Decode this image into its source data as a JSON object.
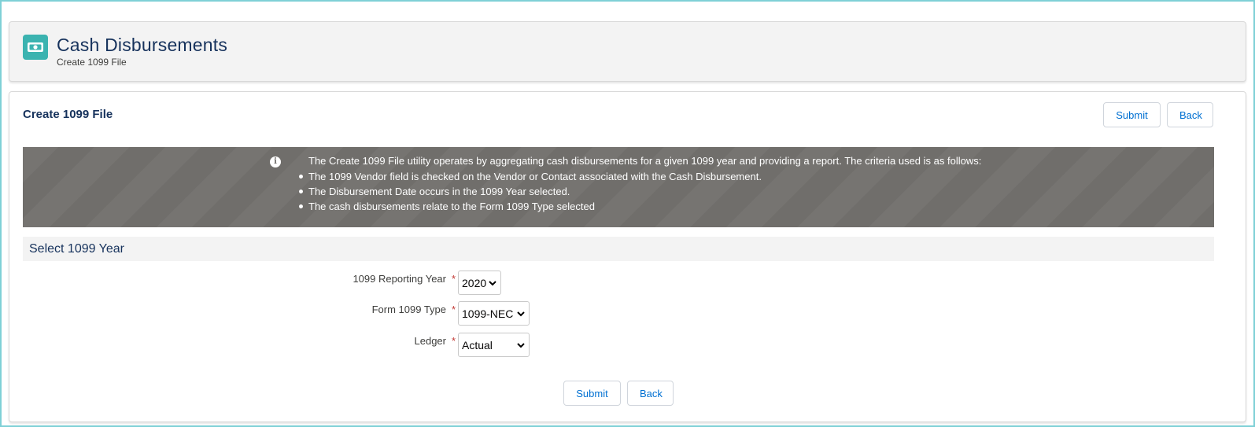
{
  "header": {
    "title": "Cash Disbursements",
    "subtitle": "Create 1099 File",
    "icon": "money-icon",
    "icon_color": "#3bb3b0"
  },
  "card": {
    "title": "Create 1099 File",
    "submit_label": "Submit",
    "back_label": "Back"
  },
  "info": {
    "icon": "info-icon",
    "intro": "The Create 1099 File utility operates by aggregating cash disbursements for a given 1099 year and providing a report. The criteria used is as follows:",
    "criteria": [
      "The 1099 Vendor field is checked on the Vendor or Contact associated with the Cash Disbursement.",
      "The Disbursement Date occurs in the 1099 Year selected.",
      "The cash disbursements relate to the Form 1099 Type selected"
    ]
  },
  "section": {
    "title": "Select 1099 Year"
  },
  "form": {
    "reporting_year": {
      "label": "1099 Reporting Year",
      "required": "*",
      "value": "2020"
    },
    "form_type": {
      "label": "Form 1099 Type",
      "required": "*",
      "value": "1099-NEC"
    },
    "ledger": {
      "label": "Ledger",
      "required": "*",
      "value": "Actual"
    }
  },
  "footer": {
    "submit_label": "Submit",
    "back_label": "Back"
  },
  "colors": {
    "title_text": "#16325c",
    "link_blue": "#0070d2",
    "banner_bg": "#706e6b",
    "required_red": "#c23934"
  }
}
